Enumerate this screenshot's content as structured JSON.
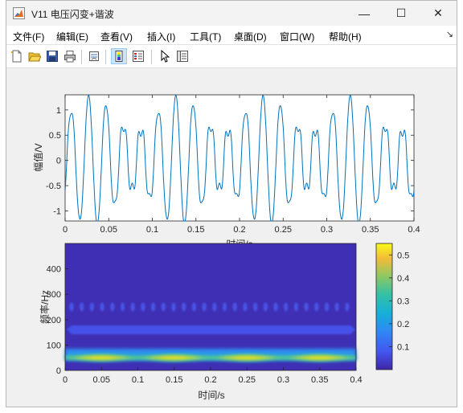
{
  "window": {
    "title": "V11 电压闪变+谐波",
    "controls": {
      "minimize": "—",
      "maximize": "☐",
      "close": "✕"
    }
  },
  "menu": [
    "文件(F)",
    "编辑(E)",
    "查看(V)",
    "插入(I)",
    "工具(T)",
    "桌面(D)",
    "窗口(W)",
    "帮助(H)"
  ],
  "menu_dock_glyph": "↘",
  "toolbar": {
    "icons": [
      "new-figure-icon",
      "open-file-icon",
      "save-icon",
      "print-icon",
      "link-figure-icon",
      "insert-colorbar-icon",
      "insert-legend-icon",
      "pointer-icon",
      "property-inspector-icon"
    ],
    "active": [
      "insert-colorbar-icon"
    ]
  },
  "chart_data": [
    {
      "type": "line",
      "title": "",
      "ylabel": "幅值/V",
      "xlabel": "时间/s",
      "xlim": [
        0,
        0.4
      ],
      "ylim": [
        -1.2,
        1.3
      ],
      "xticks": [
        "0",
        "0.05",
        "0.1",
        "0.15",
        "0.2",
        "0.25",
        "0.3",
        "0.35",
        "0.4"
      ],
      "yticks": [
        "-1",
        "-0.5",
        "0",
        "0.5",
        "1"
      ],
      "series": [
        {
          "color": "#0072bd",
          "description_values": "periodic voltage waveform with fundamental period 0.02 s; peaks alternate between about 1.3 and 1.0 (high-amplitude phase, x ≈ 0.01–0.05, 0.11–0.15, 0.21–0.25, 0.31–0.35) and flattened peaks near 0.6/-0.5 (low-amplitude phase around x ≈ 0.07, 0.17, 0.27, 0.37)"
        }
      ]
    },
    {
      "type": "heatmap",
      "xlabel": "时间/s",
      "ylabel": "频率/Hz",
      "xlim": [
        0,
        0.4
      ],
      "ylim": [
        0,
        500
      ],
      "xticks": [
        "0",
        "0.05",
        "0.1",
        "0.15",
        "0.2",
        "0.25",
        "0.3",
        "0.35",
        "0.4"
      ],
      "yticks": [
        "0",
        "100",
        "200",
        "300",
        "400"
      ],
      "colormap": "parula",
      "colorbar": {
        "min": 0,
        "max": 0.55,
        "ticks": [
          "0.1",
          "0.2",
          "0.3",
          "0.4",
          "0.5"
        ]
      },
      "features": [
        {
          "band_hz": 50,
          "max_magnitude": 0.55,
          "modulated": true
        },
        {
          "band_hz": 165,
          "magnitude": 0.12
        },
        {
          "band_hz": 250,
          "magnitude": 0.08,
          "pattern": "periodic blobs"
        }
      ]
    }
  ]
}
